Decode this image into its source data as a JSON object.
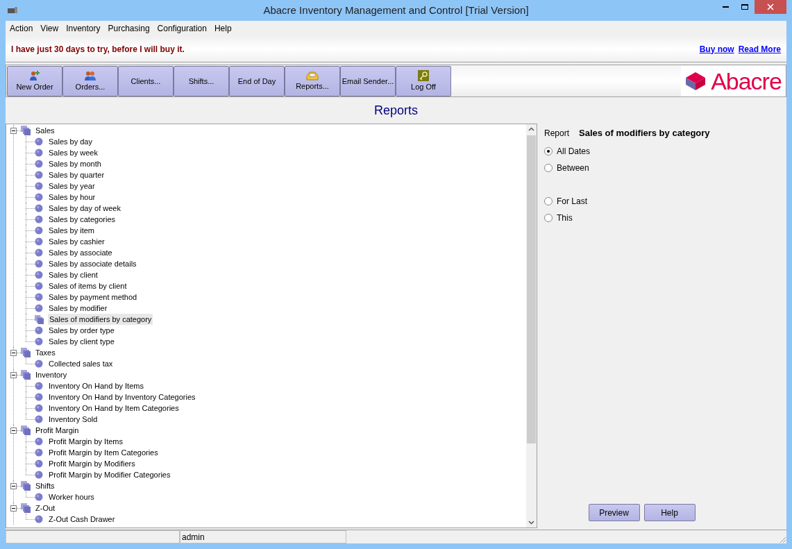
{
  "window": {
    "title": "Abacre Inventory Management and Control [Trial Version]"
  },
  "menu": [
    "Action",
    "View",
    "Inventory",
    "Purchasing",
    "Configuration",
    "Help"
  ],
  "banner": {
    "message": "I have just 30 days to try, before I will buy it.",
    "links": [
      "Buy now",
      "Read More"
    ]
  },
  "toolbar": [
    {
      "label": "New Order",
      "kind": "add-person"
    },
    {
      "label": "Orders...",
      "kind": "people"
    },
    {
      "label": "Clients...",
      "kind": "text"
    },
    {
      "label": "Shifts...",
      "kind": "text"
    },
    {
      "label": "End of Day",
      "kind": "text"
    },
    {
      "label": "Reports...",
      "kind": "tray"
    },
    {
      "label": "Email Sender...",
      "kind": "text"
    },
    {
      "label": "Log Off",
      "kind": "key"
    }
  ],
  "logo": {
    "text": "Abacre"
  },
  "heading": "Reports",
  "tree": [
    {
      "label": "Sales",
      "expanded": true,
      "children": [
        {
          "label": "Sales by day",
          "selected": false
        },
        {
          "label": "Sales by week",
          "selected": false
        },
        {
          "label": "Sales by month",
          "selected": false
        },
        {
          "label": "Sales by quarter",
          "selected": false
        },
        {
          "label": "Sales by year",
          "selected": false
        },
        {
          "label": "Sales by hour",
          "selected": false
        },
        {
          "label": "Sales by day of week",
          "selected": false
        },
        {
          "label": "Sales by categories",
          "selected": false
        },
        {
          "label": "Sales by item",
          "selected": false
        },
        {
          "label": "Sales by cashier",
          "selected": false
        },
        {
          "label": "Sales by associate",
          "selected": false
        },
        {
          "label": "Sales by associate details",
          "selected": false
        },
        {
          "label": "Sales by client",
          "selected": false
        },
        {
          "label": "Sales of items by client",
          "selected": false
        },
        {
          "label": "Sales by payment method",
          "selected": false
        },
        {
          "label": "Sales by modifier",
          "selected": false
        },
        {
          "label": "Sales of modifiers by category",
          "selected": true
        },
        {
          "label": "Sales by order type",
          "selected": false
        },
        {
          "label": "Sales by client type",
          "selected": false
        }
      ]
    },
    {
      "label": "Taxes",
      "expanded": true,
      "children": [
        {
          "label": "Collected sales tax",
          "selected": false
        }
      ]
    },
    {
      "label": "Inventory",
      "expanded": true,
      "children": [
        {
          "label": "Inventory On Hand by Items",
          "selected": false
        },
        {
          "label": "Inventory On Hand by Inventory Categories",
          "selected": false
        },
        {
          "label": "Inventory On Hand by Item Categories",
          "selected": false
        },
        {
          "label": "Inventory Sold",
          "selected": false
        }
      ]
    },
    {
      "label": "Profit Margin",
      "expanded": true,
      "children": [
        {
          "label": "Profit Margin by Items",
          "selected": false
        },
        {
          "label": "Profit Margin by Item Categories",
          "selected": false
        },
        {
          "label": "Profit Margin by Modifiers",
          "selected": false
        },
        {
          "label": "Profit Margin by Modifier Categories",
          "selected": false
        }
      ]
    },
    {
      "label": "Shifts",
      "expanded": true,
      "children": [
        {
          "label": "Worker hours",
          "selected": false
        }
      ]
    },
    {
      "label": "Z-Out",
      "expanded": true,
      "children": [
        {
          "label": "Z-Out Cash Drawer",
          "selected": false
        }
      ]
    }
  ],
  "report_panel": {
    "label": "Report",
    "name": "Sales of modifiers by category",
    "options": [
      {
        "label": "All Dates",
        "selected": true
      },
      {
        "label": "Between",
        "selected": false
      },
      {
        "label": "For Last",
        "selected": false
      },
      {
        "label": "This",
        "selected": false
      }
    ],
    "buttons": [
      "Preview",
      "Help"
    ]
  },
  "status_bar": {
    "pane_2": "admin"
  }
}
